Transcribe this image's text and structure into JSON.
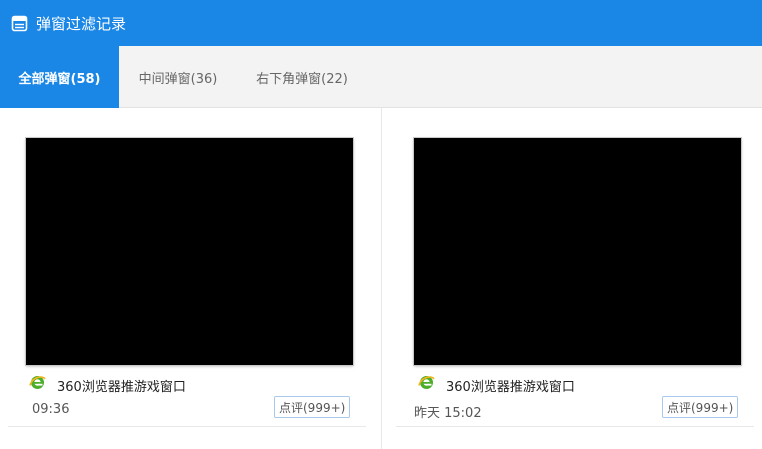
{
  "window": {
    "title": "弹窗过滤记录",
    "icon": "window-icon"
  },
  "tabs": [
    {
      "label": "全部弹窗(58)",
      "active": true
    },
    {
      "label": "中间弹窗(36)",
      "active": false
    },
    {
      "label": "右下角弹窗(22)",
      "active": false
    }
  ],
  "cards": [
    {
      "app_icon": "ie-browser-icon",
      "title": "360浏览器推游戏窗口",
      "time": "09:36",
      "review_label": "点评(999+)"
    },
    {
      "app_icon": "ie-browser-icon",
      "title": "360浏览器推游戏窗口",
      "time": "昨天 15:02",
      "review_label": "点评(999+)"
    }
  ],
  "colors": {
    "accent": "#1a86e6",
    "tabbar_bg": "#f3f3f3",
    "thumbnail": "#000000",
    "app_icon_green": "#4cae2a"
  }
}
